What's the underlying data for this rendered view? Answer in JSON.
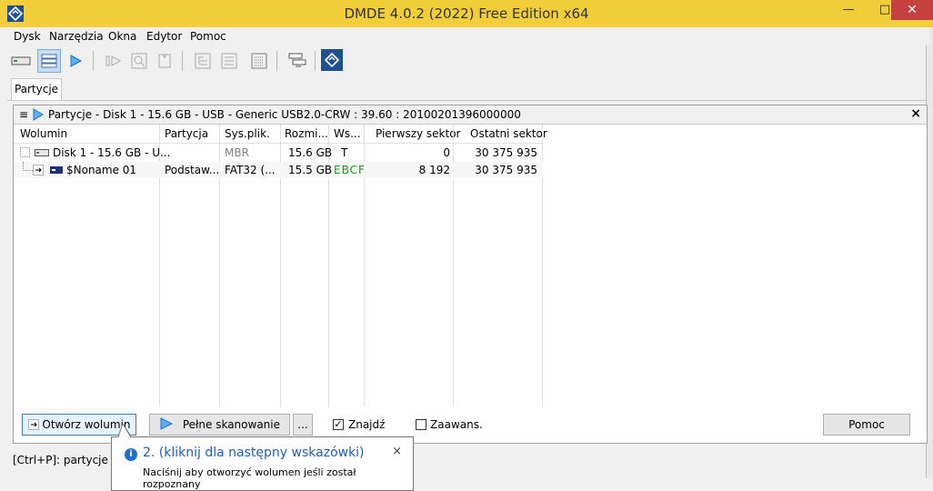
{
  "window": {
    "title": "DMDE 4.0.2 (2022) Free Edition x64",
    "min_label": "—",
    "max_label": "□",
    "close_label": "✕"
  },
  "menu": [
    "Dysk",
    "Narzędzia",
    "Okna",
    "Edytor",
    "Pomoc"
  ],
  "tabs": [
    {
      "label": "Partycje"
    }
  ],
  "panel": {
    "title": "Partycje - Disk 1 - 15.6 GB - USB - Generic USB2.0-CRW : 39.60 : 20100201396000000",
    "close": "×"
  },
  "table": {
    "columns": [
      "Wolumin",
      "Partycja",
      "Sys.plik.",
      "Rozmi...",
      "Ws...",
      "Pierwszy sektor",
      "Ostatni sektor"
    ],
    "rows": [
      {
        "volume": "Disk 1 - 15.6 GB - U...",
        "partition": "",
        "fs": "MBR",
        "size": "15.6 GB",
        "flag": "T",
        "first": "0",
        "last": "30 375 935"
      },
      {
        "volume": "$Noname 01",
        "partition": "Podstaw...",
        "fs": "FAT32 (...",
        "size": "15.5 GB",
        "flag": "EBCF",
        "first": "8 192",
        "last": "30 375 935"
      }
    ]
  },
  "buttons": {
    "open_volume": "Otwórz wolumin",
    "full_scan": "Pełne skanowanie",
    "more": "...",
    "help": "Pomoc"
  },
  "checkboxes": {
    "find": {
      "label": "Znajdź",
      "checked": true,
      "mark": "✓"
    },
    "advanced": {
      "label": "Zaawans.",
      "checked": false
    }
  },
  "status": {
    "text": "[Ctrl+P]: partycje  [F1"
  },
  "tooltip": {
    "title": "2. (kliknij dla następny wskazówki)",
    "body": "Naciśnij aby otworzyć wolumen jeśli został rozpoznany",
    "close": "×",
    "info_glyph": "i"
  },
  "colors": {
    "titlebar": "#f2ce3a",
    "accent_blue": "#1f6fd1",
    "ebcf_green": "#1a9a1a",
    "mbr_gray": "#808080"
  }
}
